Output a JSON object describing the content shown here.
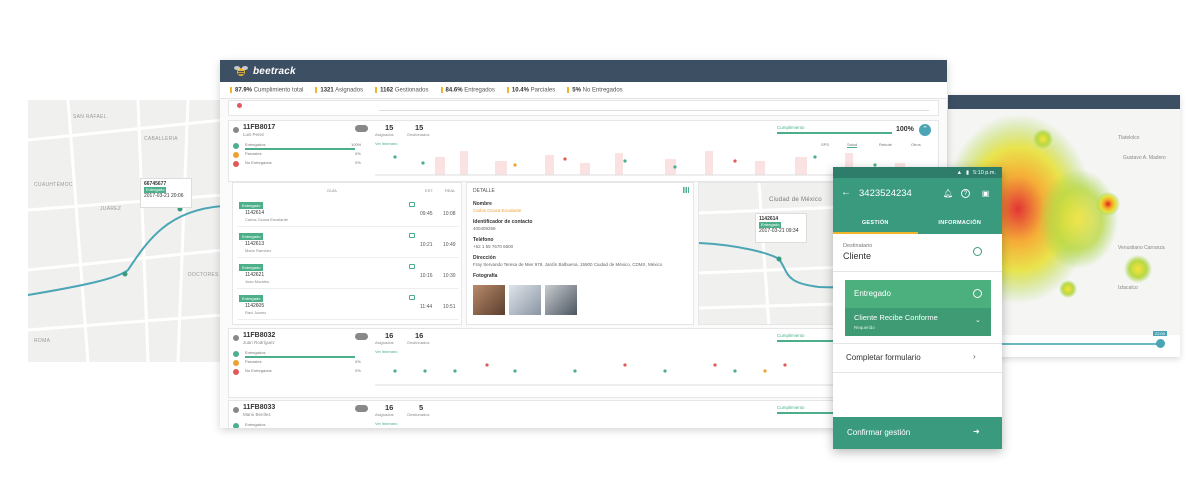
{
  "brand": {
    "name": "beetrack"
  },
  "stats": [
    {
      "value": "87.9%",
      "label": "Cumplimiento total"
    },
    {
      "value": "1321",
      "label": "Asignados"
    },
    {
      "value": "1162",
      "label": "Gestionados"
    },
    {
      "value": "84.6%",
      "label": "Entregados"
    },
    {
      "value": "10.4%",
      "label": "Parciales"
    },
    {
      "value": "5%",
      "label": "No Entregados"
    }
  ],
  "routes": [
    {
      "id": "11FB8017",
      "driver": "Luis Perez",
      "assigned": "15",
      "assigned_label": "Asignados",
      "managed": "15",
      "managed_label": "Gestionados",
      "link": "Ver itinerario",
      "compliance_label": "Cumplimiento",
      "compliance": "100%",
      "statuses": [
        {
          "label": "Entregados",
          "pct": "100%"
        },
        {
          "label": "Parciales",
          "pct": "0%"
        },
        {
          "label": "No Entregados",
          "pct": "0%"
        }
      ],
      "tabs": [
        "SPS",
        "Salud",
        "Rebote",
        "Otros"
      ]
    },
    {
      "id": "11FB8032",
      "driver": "Juan Rodríguez",
      "assigned": "16",
      "assigned_label": "Asignados",
      "managed": "16",
      "managed_label": "Gestionados",
      "link": "Ver itinerario",
      "compliance_label": "Cumplimiento",
      "statuses": [
        {
          "label": "Entregados",
          "pct": ""
        },
        {
          "label": "Parciales",
          "pct": "0%"
        },
        {
          "label": "No Entregados",
          "pct": "0%"
        }
      ]
    },
    {
      "id": "11FB8033",
      "driver": "Mario Benítez",
      "assigned": "16",
      "assigned_label": "Asignados",
      "managed": "5",
      "managed_label": "Gestionados",
      "link": "Ver itinerario",
      "compliance_label": "Cumplimiento",
      "statuses": [
        {
          "label": "Entregados",
          "pct": ""
        }
      ]
    }
  ],
  "dispatch_list": {
    "headers": [
      "GUÍA",
      "EST.",
      "REAL"
    ],
    "items": [
      {
        "status": "Entregado",
        "id": "1142614",
        "name": "Carlos Ocosa Escalante",
        "est": "09:45",
        "real": "10:08"
      },
      {
        "status": "Entregado",
        "id": "1142613",
        "name": "Mario Ramírez",
        "est": "10:21",
        "real": "10:49"
      },
      {
        "status": "Entregado",
        "id": "1142621",
        "name": "Juan Morales",
        "est": "10:16",
        "real": "10:30"
      },
      {
        "status": "Entregado",
        "id": "1142605",
        "name": "Ravi Juarez",
        "est": "11:44",
        "real": "10:51"
      }
    ]
  },
  "detail": {
    "title": "DETALLE",
    "fields": [
      {
        "label": "Nombre",
        "value": "Carlos Ocosa Escalante"
      },
      {
        "label": "Identificador de contacto",
        "value": "400408269"
      },
      {
        "label": "Teléfono",
        "value": "+52 1 55 7670 6600"
      },
      {
        "label": "Dirección",
        "value": "Fray Servando Teresa de Mier 978, Jardín Balbuena, 15900 Ciudad de México, CDMX, México"
      },
      {
        "label": "Fotografía",
        "value": ""
      }
    ]
  },
  "mini_map": {
    "city": "Ciudad de México",
    "card": {
      "id": "1142614",
      "status": "Entregado",
      "time": "2017-03-21 09:34"
    }
  },
  "left_map": {
    "streets": [
      "SAN RAFAEL",
      "CABALLERIA",
      "CUAUHTÉMOC",
      "JUÁREZ",
      "DOCTORES",
      "ROMA"
    ],
    "card": {
      "id": "66745677",
      "status": "Entregado",
      "time": "2017-03-21 20:06"
    }
  },
  "heatmap": {
    "places": [
      "Tlatelolco",
      "Gustavo A. Madero",
      "Venustiano Carranza",
      "Iztacalco",
      "Ciudad de México"
    ],
    "slider_value": "22:00"
  },
  "phone": {
    "time": "5:10 p.m.",
    "title": "3423524234",
    "tabs": [
      "GESTIÓN",
      "INFORMACIÓN"
    ],
    "recipient_label": "Destinatario",
    "recipient": "Cliente",
    "status": "Entregado",
    "sub_status": "Cliente Recibe Conforme",
    "required": "Requerido",
    "form": "Completar formulario",
    "confirm": "Confirmar gestión"
  },
  "colors": {
    "header": "#3d4f63",
    "accent_green": "#4caf8a",
    "phone_green": "#3a9a7e",
    "teal": "#4aa5b5",
    "stat_marker": "#f0b429"
  }
}
